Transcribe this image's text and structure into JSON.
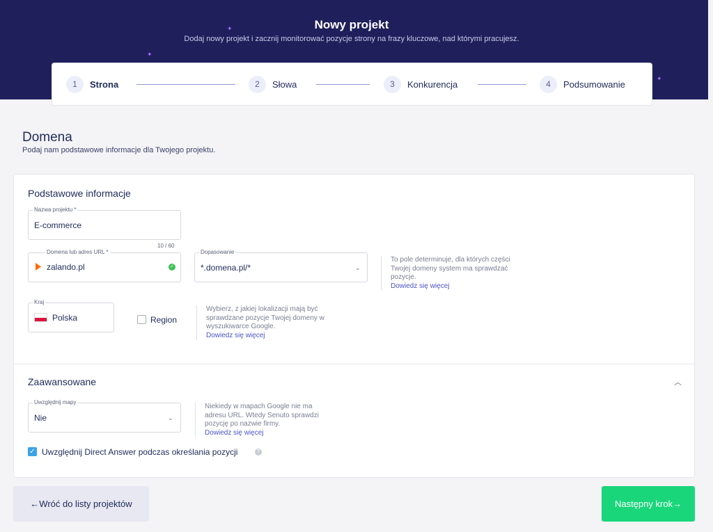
{
  "header": {
    "title": "Nowy projekt",
    "subtitle": "Dodaj nowy projekt i zacznij monitorować pozycje strony na frazy kluczowe, nad którymi pracujesz."
  },
  "steps": [
    {
      "number": "1",
      "label": "Strona"
    },
    {
      "number": "2",
      "label": "Słowa"
    },
    {
      "number": "3",
      "label": "Konkurencja"
    },
    {
      "number": "4",
      "label": "Podsumowanie"
    }
  ],
  "domain_section": {
    "title": "Domena",
    "subtitle": "Podaj nam podstawowe informacje dla Twojego projektu."
  },
  "basic_info": {
    "title": "Podstawowe informacje",
    "project_name": {
      "label": "Nazwa projektu *",
      "value": "E-commerce",
      "counter": "10 / 60"
    },
    "domain": {
      "label": "Domena lub adres URL *",
      "value": "zalando.pl"
    },
    "match": {
      "label": "Dopasowanie",
      "value": "*.domena.pl/*"
    },
    "match_help": {
      "text": "To pole determinuje, dla których części Twojej domeny system ma sprawdzać pozycje.",
      "link": "Dowiedz się więcej"
    },
    "country": {
      "label": "Kraj",
      "value": "Polska"
    },
    "region_label": "Region",
    "country_help": {
      "text": "Wybierz, z jakiej lokalizacji mają być sprawdzane pozycje Twojej domeny w wyszukiwarce Google.",
      "link": "Dowiedz się więcej"
    }
  },
  "advanced": {
    "title": "Zaawansowane",
    "maps": {
      "label": "Uwzględnij mapy",
      "value": "Nie"
    },
    "maps_help": {
      "text": "Niekiedy w mapach Google nie ma adresu URL. Wtedy Senuto sprawdzi pozycję po nazwie firmy.",
      "link": "Dowiedz się więcej"
    },
    "direct_answer_label": "Uwzględnij Direct Answer podczas określania pozycji"
  },
  "footer": {
    "back_label": "Wróć do listy projektów",
    "next_label": "Następny krok"
  },
  "colors": {
    "hero": "#1f1f5c",
    "next_button": "#19d67a",
    "link": "#4a53c6"
  }
}
